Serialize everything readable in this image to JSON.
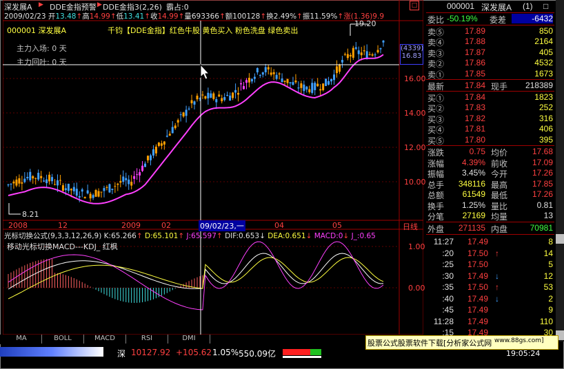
{
  "header": {
    "stock_name": "深发展A",
    "indicator_warn": "DDE金指预警",
    "indicator_name": "DDE金指3",
    "indicator_params": "(2,26)",
    "indicator_extra": "霸占:0",
    "date": "2009/02/23",
    "open_label": "开",
    "open": "13.48",
    "high_label": "高",
    "high": "14.99",
    "low_label": "低",
    "low": "13.41",
    "close_label": "收",
    "close": "14.99",
    "volume_label": "量",
    "volume": "693366",
    "amount_label": "额",
    "amount": "100128",
    "turnover_label": "换",
    "turnover": "2.49%",
    "amplitude_label": "振",
    "amplitude": "11.59%",
    "change_label": "涨",
    "change": "(1.36)",
    "change_pct": "9.9",
    "code_line": "000001 深发展A",
    "legend": "千钧【DDE金指】红色牛股 黄色买入 粉色洗盘 绿色卖出",
    "main_entry": "主力入场:  0 天",
    "main_exit": "主力回叶:  0 天"
  },
  "main_chart": {
    "price_high_label": "19.20",
    "price_low_label": "8.21",
    "y_ticks": [
      "16.00",
      "14.00",
      "12.00",
      "10.00"
    ],
    "current_tag_top": "(4339)",
    "current_tag_bottom": "16.83",
    "x_labels": [
      "2008",
      "12",
      "2009",
      "02",
      "09/02/23,一",
      "04",
      "05"
    ],
    "period_label": "日线",
    "colors": {
      "up": "#40a0ff",
      "down": "#ffa000",
      "ma": "#ff40ff",
      "cross": "#ffffff"
    }
  },
  "sub_chart": {
    "title": "光标切换公式",
    "params": "(9,3,3,12,26,9)",
    "k": "K:65.266",
    "d": "D:65.101",
    "j": "J:65.597",
    "dif": "DIF:0.653",
    "dea": "DEA:0.651",
    "macd": "MACD:0",
    "j2": "J_:0.65",
    "subtitle": "移动光标切换MACD---KDJ_ 红枫",
    "y_ticks": [
      "1.00",
      "0.00"
    ]
  },
  "tabs": [
    "MA",
    "BOLL",
    "MACD",
    "RSI",
    "DMI"
  ],
  "quote": {
    "code": "000001",
    "name": "深发展A",
    "count": "(1)",
    "weibi_label": "委比",
    "weibi": "-50.19%",
    "weicha_label": "委差",
    "weicha": "-6432",
    "sell": [
      {
        "label": "卖⑤",
        "price": "17.89",
        "vol": "850"
      },
      {
        "label": "卖④",
        "price": "17.88",
        "vol": "2164"
      },
      {
        "label": "卖③",
        "price": "17.87",
        "vol": "405"
      },
      {
        "label": "卖②",
        "price": "17.86",
        "vol": "4532"
      },
      {
        "label": "卖①",
        "price": "17.85",
        "vol": "1673"
      }
    ],
    "latest_label": "最新",
    "latest": "17.84",
    "hand_label": "现手",
    "hand": "218389",
    "buy": [
      {
        "label": "买①",
        "price": "17.84",
        "vol": "1823"
      },
      {
        "label": "买②",
        "price": "17.83",
        "vol": "252"
      },
      {
        "label": "买③",
        "price": "17.82",
        "vol": "316"
      },
      {
        "label": "买④",
        "price": "17.81",
        "vol": "406"
      },
      {
        "label": "买⑤",
        "price": "17.80",
        "vol": "395"
      }
    ],
    "stats": [
      {
        "l1": "涨跌",
        "v1": "0.75",
        "l2": "均价",
        "v2": "17.68"
      },
      {
        "l1": "涨幅",
        "v1": "4.39%",
        "l2": "前收",
        "v2": "17.09"
      },
      {
        "l1": "振幅",
        "v1": "3.45%",
        "l2": "今开",
        "v2": "17.26"
      },
      {
        "l1": "总手",
        "v1": "348116",
        "l2": "最高",
        "v2": "17.85"
      },
      {
        "l1": "总额",
        "v1": "61549",
        "l2": "最低",
        "v2": "17.26"
      },
      {
        "l1": "换手",
        "v1": "1.25%",
        "l2": "量比",
        "v2": "0.81"
      },
      {
        "l1": "分笔",
        "v1": "27169",
        "l2": "均量",
        "v2": "13"
      }
    ],
    "outer_label": "外盘",
    "outer": "271135",
    "inner_label": "内盘",
    "inner": "70981",
    "ticks": [
      {
        "time": "11:27",
        "price": "17.49",
        "arrow": "",
        "vol": "8"
      },
      {
        "time": ":20",
        "price": "17.50",
        "arrow": "↑",
        "vol": "14"
      },
      {
        "time": ":25",
        "price": "17.50",
        "arrow": "",
        "vol": "5"
      },
      {
        "time": ":30",
        "price": "17.49",
        "arrow": "↓",
        "vol": "12"
      },
      {
        "time": ":35",
        "price": "17.50",
        "arrow": "↑",
        "vol": "53"
      },
      {
        "time": ":40",
        "price": "17.49",
        "arrow": "↓",
        "vol": "2"
      },
      {
        "time": ":45",
        "price": "17.49",
        "arrow": "",
        "vol": "9"
      },
      {
        "time": "11:28",
        "price": "17.49",
        "arrow": "",
        "vol": "110"
      },
      {
        "time": ":15",
        "price": "17.49",
        "arrow": "",
        "vol": "30"
      }
    ]
  },
  "status": {
    "index_name": "深",
    "index_value": "10127.92",
    "index_change": "+105.62",
    "index_pct": "1.05%",
    "index_amount": "550.09亿",
    "time": "19:05:24",
    "ad_text": "股票公式股票软件下载[分析家公式网",
    "ad_url": "www.88gs.com]"
  }
}
